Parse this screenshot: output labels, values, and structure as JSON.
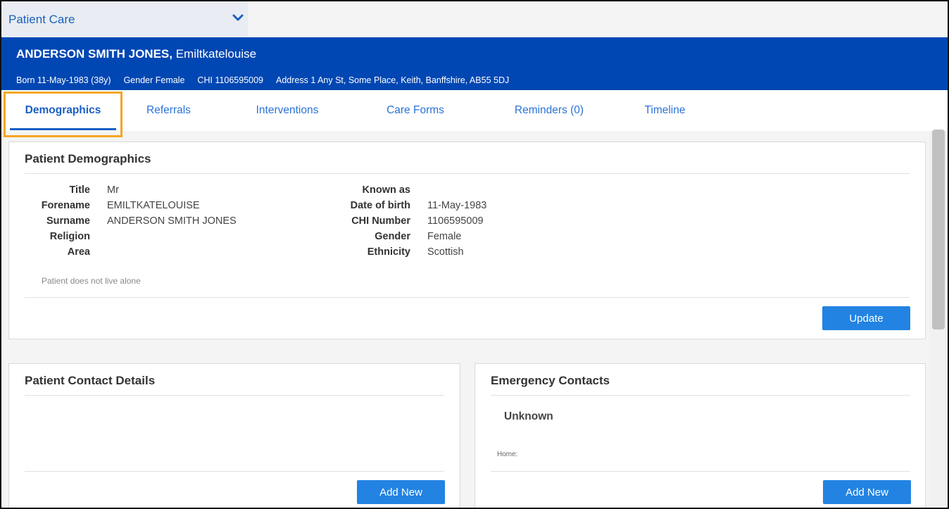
{
  "module": {
    "label": "Patient Care"
  },
  "patient": {
    "surname": "ANDERSON SMITH JONES,",
    "forename": "Emiltkatelouise",
    "born": "Born 11-May-1983 (38y)",
    "gender": "Gender Female",
    "chi": "CHI 1106595009",
    "address": "Address 1 Any St, Some Place, Keith, Banffshire, AB55 5DJ"
  },
  "tabs": [
    {
      "label": "Demographics"
    },
    {
      "label": "Referrals"
    },
    {
      "label": "Interventions"
    },
    {
      "label": "Care Forms"
    },
    {
      "label": "Reminders (0)"
    },
    {
      "label": "Timeline"
    }
  ],
  "demographics": {
    "title": "Patient Demographics",
    "left": [
      {
        "label": "Title",
        "value": "Mr"
      },
      {
        "label": "Forename",
        "value": "EMILTKATELOUISE"
      },
      {
        "label": "Surname",
        "value": "ANDERSON SMITH JONES"
      },
      {
        "label": "Religion",
        "value": ""
      },
      {
        "label": "Area",
        "value": ""
      }
    ],
    "right": [
      {
        "label": "Known as",
        "value": ""
      },
      {
        "label": "Date of birth",
        "value": "11-May-1983"
      },
      {
        "label": "CHI Number",
        "value": "1106595009"
      },
      {
        "label": "Gender",
        "value": "Female"
      },
      {
        "label": "Ethnicity",
        "value": "Scottish"
      }
    ],
    "note": "Patient does not live alone",
    "update_label": "Update"
  },
  "contact_details": {
    "title": "Patient Contact Details",
    "add_label": "Add New"
  },
  "emergency": {
    "title": "Emergency Contacts",
    "contact_name": "Unknown",
    "home_label": "Home:",
    "add_label": "Add New"
  },
  "colors": {
    "banner": "#0047b3",
    "accent": "#2283e2",
    "highlight": "#f5a623"
  }
}
